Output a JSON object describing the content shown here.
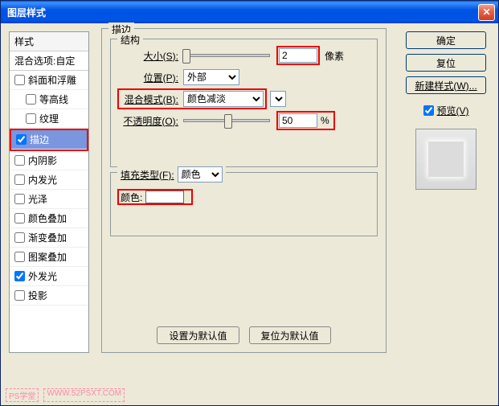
{
  "title": "图层样式",
  "styles": {
    "header": "样式",
    "blend": "混合选项:自定",
    "items": [
      {
        "label": "斜面和浮雕",
        "checked": false,
        "indent": 0
      },
      {
        "label": "等高线",
        "checked": false,
        "indent": 1
      },
      {
        "label": "纹理",
        "checked": false,
        "indent": 1
      },
      {
        "label": "描边",
        "checked": true,
        "indent": 0
      },
      {
        "label": "内阴影",
        "checked": false,
        "indent": 0
      },
      {
        "label": "内发光",
        "checked": false,
        "indent": 0
      },
      {
        "label": "光泽",
        "checked": false,
        "indent": 0
      },
      {
        "label": "颜色叠加",
        "checked": false,
        "indent": 0
      },
      {
        "label": "渐变叠加",
        "checked": false,
        "indent": 0
      },
      {
        "label": "图案叠加",
        "checked": false,
        "indent": 0
      },
      {
        "label": "外发光",
        "checked": true,
        "indent": 0
      },
      {
        "label": "投影",
        "checked": false,
        "indent": 0
      }
    ]
  },
  "main": {
    "legend": "描边",
    "structure": {
      "legend": "结构",
      "size_label": "大小(S):",
      "size_value": "2",
      "size_unit": "像素",
      "position_label": "位置(P):",
      "position_value": "外部",
      "blend_label": "混合模式(B):",
      "blend_value": "颜色减淡",
      "opacity_label": "不透明度(O):",
      "opacity_value": "50",
      "opacity_unit": "%"
    },
    "fill": {
      "legend_label": "填充类型(F):",
      "fill_value": "颜色",
      "color_label": "颜色:",
      "color_value": "#ffffff"
    },
    "default_btn": "设置为默认值",
    "reset_btn": "复位为默认值"
  },
  "right": {
    "ok": "确定",
    "reset": "复位",
    "new_style": "新建样式(W)...",
    "preview_label": "预览(V)",
    "preview_checked": true
  },
  "footer": {
    "badge1": "PS学堂",
    "badge2": "WWW.52PSXT.COM"
  }
}
